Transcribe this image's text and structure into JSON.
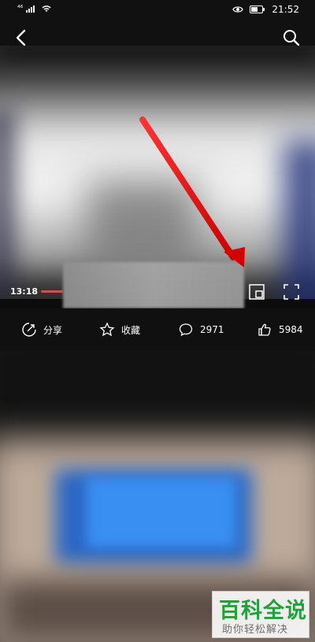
{
  "status_bar": {
    "network": "⁴⁶",
    "time": "21:52"
  },
  "player": {
    "current_time": "13:18",
    "progress": 0.07
  },
  "actions": {
    "share": "分享",
    "favorite": "收藏",
    "comments": "2971",
    "likes": "5984"
  },
  "watermark": {
    "title": "百科全说",
    "subtitle": "助你轻松解决"
  },
  "colors": {
    "accent_red": "#e14848",
    "watermark_green": "#1ea33a"
  },
  "icons": {
    "back": "back-icon",
    "search": "search-icon",
    "pip": "pip-icon",
    "fullscreen": "fullscreen-icon",
    "share": "share-icon",
    "favorite": "star-icon",
    "comment": "comment-icon",
    "like": "thumb-up-icon"
  }
}
